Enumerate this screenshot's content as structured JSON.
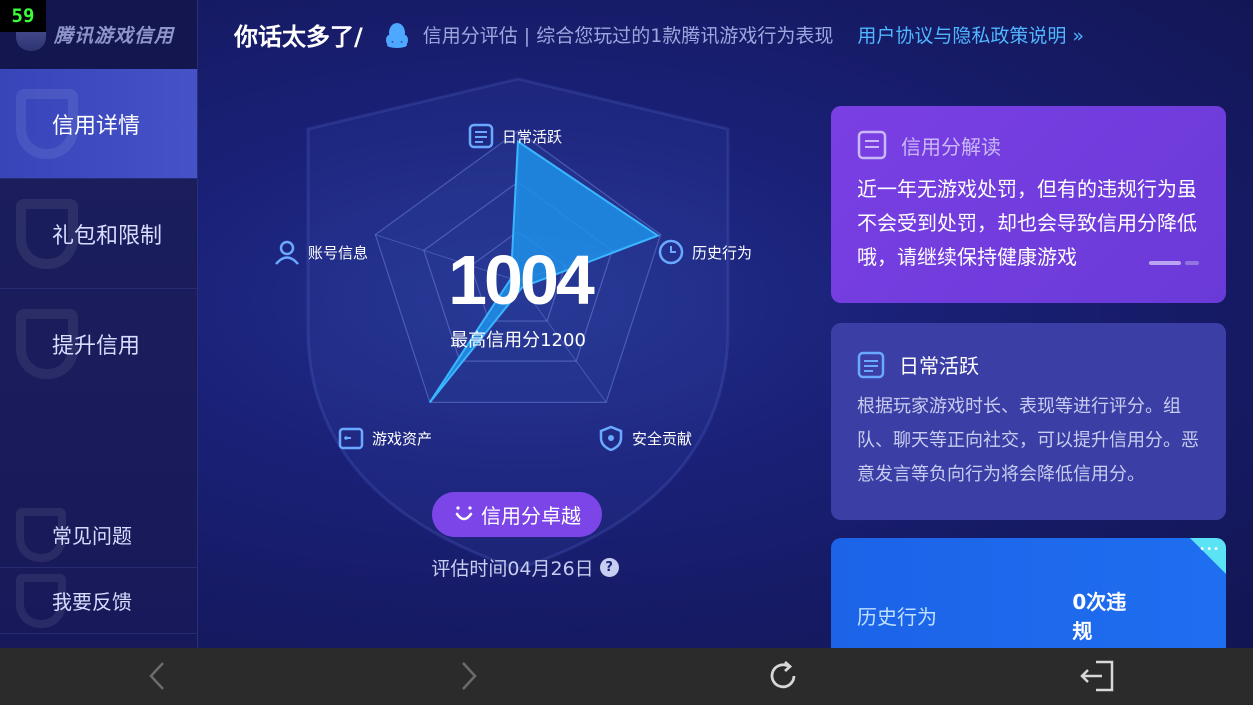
{
  "fps_counter": "59",
  "brand": {
    "name": "腾讯游戏信用"
  },
  "sidebar": {
    "items": [
      {
        "label": "信用详情",
        "active": true
      },
      {
        "label": "礼包和限制",
        "active": false
      },
      {
        "label": "提升信用",
        "active": false
      }
    ],
    "bottom_items": [
      {
        "label": "常见问题"
      },
      {
        "label": "我要反馈"
      }
    ]
  },
  "header": {
    "username": "你话太多了/",
    "subtitle": "信用分评估 | 综合您玩过的1款腾讯游戏行为表现",
    "policy_link": "用户协议与隐私政策说明 »"
  },
  "radar": {
    "score": "1004",
    "max_score_text": "最高信用分1200",
    "dimensions": [
      {
        "label": "日常活跃",
        "icon": "doc-icon"
      },
      {
        "label": "历史行为",
        "icon": "clock-icon"
      },
      {
        "label": "安全贡献",
        "icon": "shield-icon"
      },
      {
        "label": "游戏资产",
        "icon": "wallet-icon"
      },
      {
        "label": "账号信息",
        "icon": "user-icon"
      }
    ],
    "values": [
      0.93,
      0.98,
      0.05,
      1.0,
      0.05
    ],
    "level_button": "信用分卓越",
    "eval_time": "评估时间04月26日",
    "help_icon": "?"
  },
  "cards": {
    "interpret": {
      "title": "信用分解读",
      "body": "近一年无游戏处罚，但有的违规行为虽不会受到处罚，却也会导致信用分降低哦，请继续保持健康游戏"
    },
    "daily": {
      "title": "日常活跃",
      "body": "根据玩家游戏时长、表现等进行评分。组队、聊天等正向社交，可以提升信用分。恶意发言等负向行为将会降低信用分。"
    },
    "history": {
      "label": "历史行为",
      "value": "0次违规"
    }
  },
  "colors": {
    "accent_purple": "#7b45e8",
    "radar_fill": "#1e90e8",
    "link_blue": "#4fb6ff",
    "card_blue": "#1f6ef0"
  },
  "system_bar": {
    "icons": [
      "back-icon",
      "forward-icon",
      "refresh-icon",
      "exit-icon"
    ]
  }
}
